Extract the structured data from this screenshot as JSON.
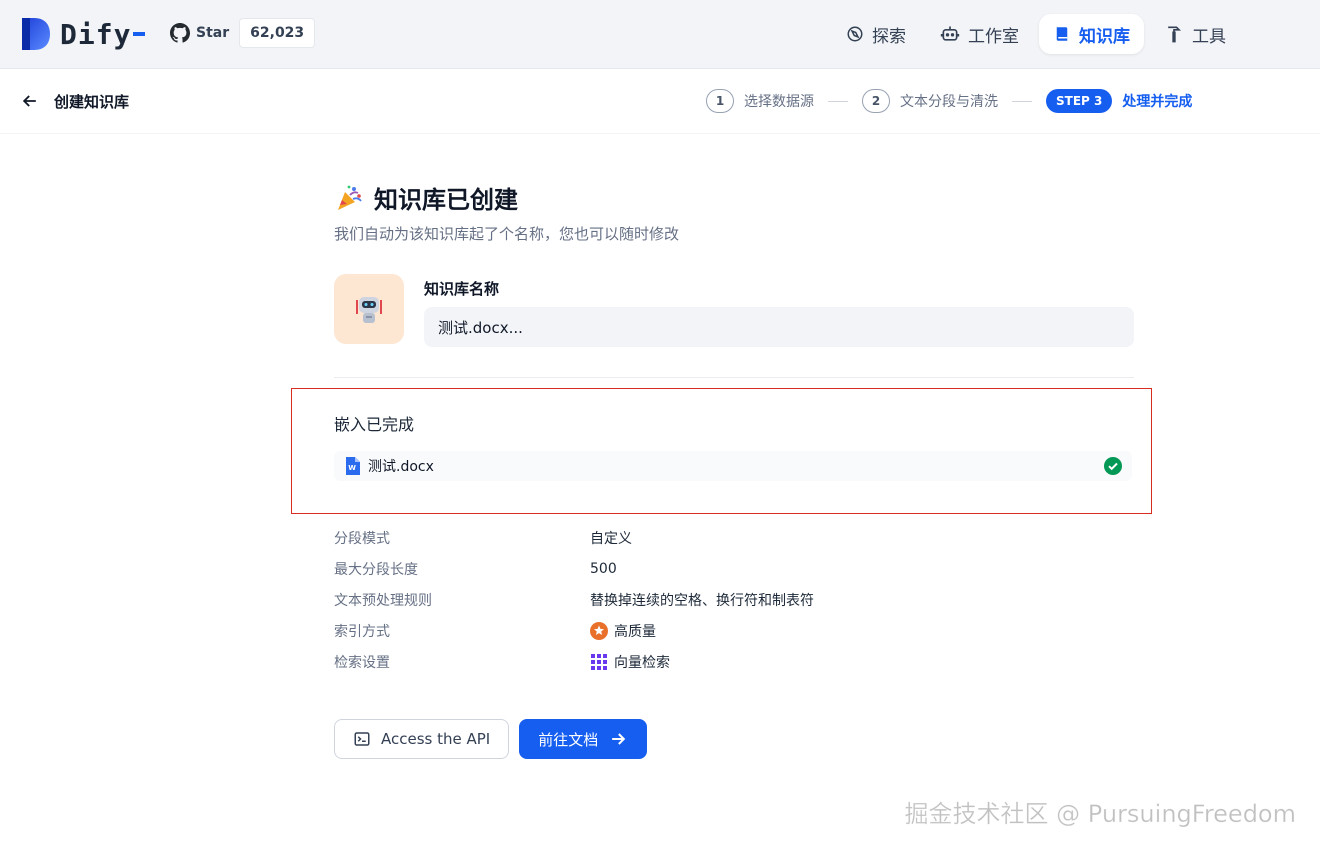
{
  "app": {
    "name": "Dify"
  },
  "github": {
    "star_label": "Star",
    "count": "62,023"
  },
  "nav": {
    "items": [
      {
        "label": "探索",
        "icon": "compass-icon",
        "active": false
      },
      {
        "label": "工作室",
        "icon": "robot-icon",
        "active": false
      },
      {
        "label": "知识库",
        "icon": "book-icon",
        "active": true
      },
      {
        "label": "工具",
        "icon": "hammer-icon",
        "active": false
      }
    ]
  },
  "subheader": {
    "title": "创建知识库",
    "steps": [
      {
        "num": "1",
        "label": "选择数据源"
      },
      {
        "num": "2",
        "label": "文本分段与清洗"
      },
      {
        "badge": "STEP 3",
        "label": "处理并完成"
      }
    ]
  },
  "main": {
    "heading": "知识库已创建",
    "subtitle": "我们自动为该知识库起了个名称，您也可以随时修改",
    "name_label": "知识库名称",
    "name_value": "测试.docx..."
  },
  "embedding": {
    "title": "嵌入已完成",
    "file": "测试.docx"
  },
  "properties": [
    {
      "key": "分段模式",
      "value": "自定义"
    },
    {
      "key": "最大分段长度",
      "value": "500"
    },
    {
      "key": "文本预处理规则",
      "value": "替换掉连续的空格、换行符和制表符"
    },
    {
      "key": "索引方式",
      "value": "高质量",
      "icon": "star-badge-icon"
    },
    {
      "key": "检索设置",
      "value": "向量检索",
      "icon": "grid-icon"
    }
  ],
  "actions": {
    "api_label": "Access the API",
    "docs_label": "前往文档"
  },
  "watermark": "掘金技术社区 @ PursuingFreedom",
  "colors": {
    "primary": "#155eef",
    "success": "#039855",
    "highlight_border": "#d92d20"
  }
}
